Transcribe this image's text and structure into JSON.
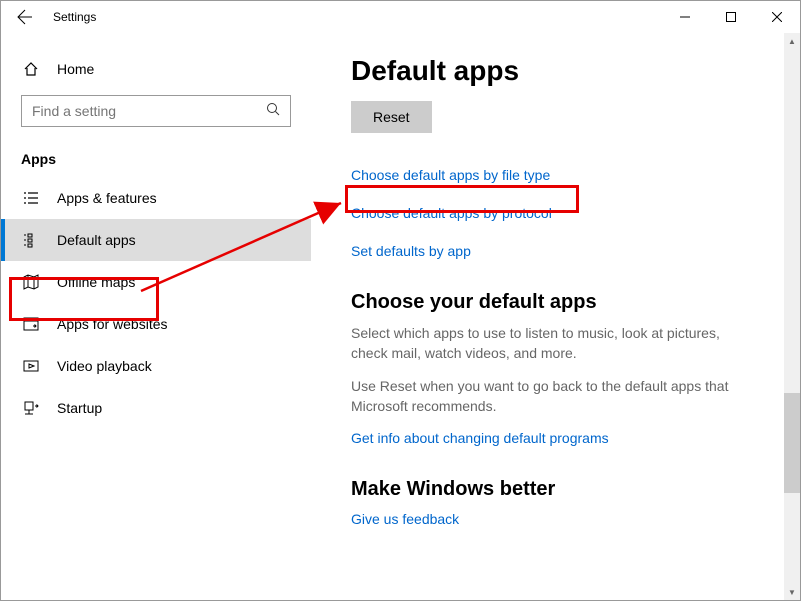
{
  "titlebar": {
    "title": "Settings"
  },
  "sidebar": {
    "home_label": "Home",
    "search_placeholder": "Find a setting",
    "section_label": "Apps",
    "items": [
      {
        "label": "Apps & features"
      },
      {
        "label": "Default apps"
      },
      {
        "label": "Offline maps"
      },
      {
        "label": "Apps for websites"
      },
      {
        "label": "Video playback"
      },
      {
        "label": "Startup"
      }
    ]
  },
  "main": {
    "page_title": "Default apps",
    "reset_label": "Reset",
    "link_file_type": "Choose default apps by file type",
    "link_protocol": "Choose default apps by protocol",
    "link_by_app": "Set defaults by app",
    "choose_title": "Choose your default apps",
    "choose_desc": "Select which apps to use to listen to music, look at pictures, check mail, watch videos, and more.",
    "reset_desc": "Use Reset when you want to go back to the default apps that Microsoft recommends.",
    "link_info": "Get info about changing default programs",
    "better_title": "Make Windows better",
    "link_feedback": "Give us feedback"
  }
}
